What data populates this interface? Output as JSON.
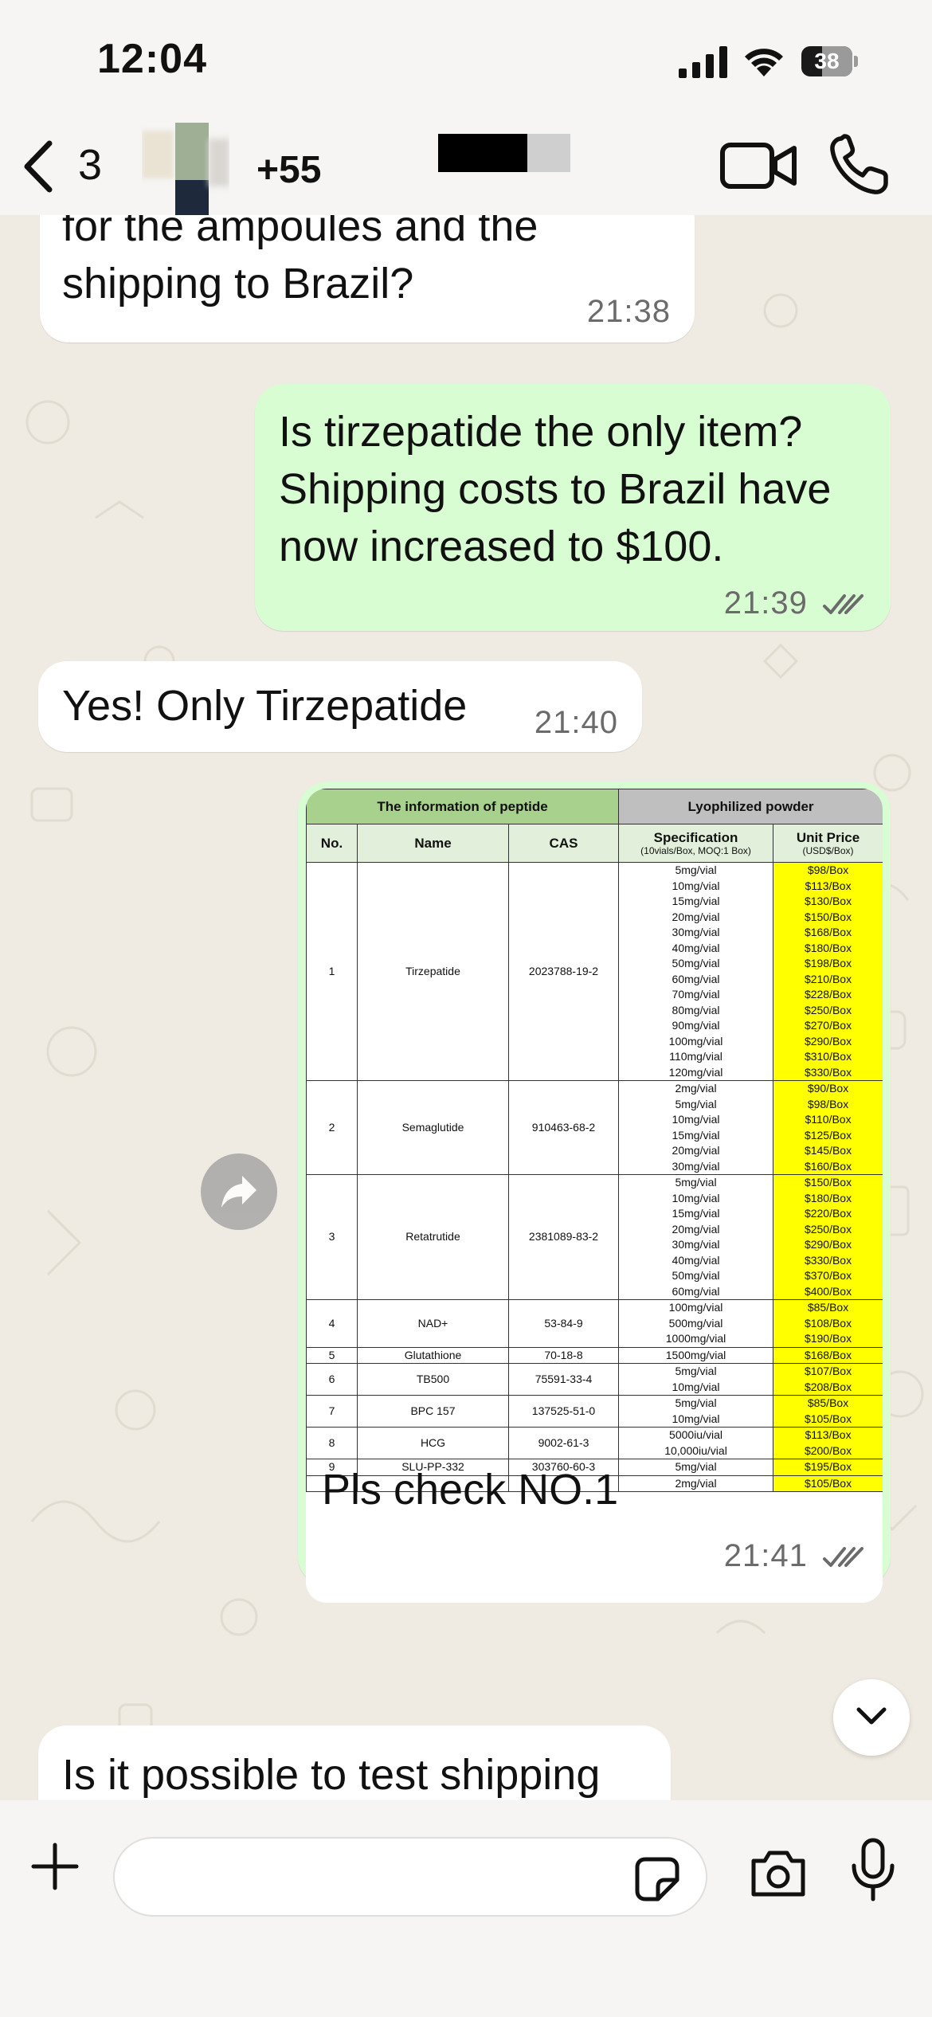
{
  "status_bar": {
    "time": "12:04",
    "battery": "38"
  },
  "header": {
    "back_count": "3",
    "contact_name": "+55"
  },
  "messages": [
    {
      "direction": "in",
      "lines": [
        "for the ampoules and the",
        "shipping to Brazil?"
      ],
      "time": "21:38"
    },
    {
      "direction": "out",
      "lines": [
        "Is tirzepatide the only item?",
        "Shipping costs to Brazil have",
        "now increased to $100."
      ],
      "time": "21:39"
    },
    {
      "direction": "in",
      "lines": [
        "Yes! Only Tirzepatide"
      ],
      "time": "21:40"
    },
    {
      "direction": "out",
      "lines": [
        "Pls check NO.1"
      ],
      "time": "21:41"
    },
    {
      "direction": "in",
      "lines": [
        "Is it possible to test shipping"
      ]
    }
  ],
  "price_table": {
    "group_header_left": "The information of peptide",
    "group_header_right": "Lyophilized powder",
    "col_no": "No.",
    "col_name": "Name",
    "col_cas": "CAS",
    "col_spec": "Specification",
    "col_spec_sub": "(10vials/Box, MOQ:1 Box)",
    "col_price": "Unit Price",
    "col_price_sub": "(USD$/Box)",
    "rows": [
      {
        "no": "1",
        "name": "Tirzepatide",
        "cas": "2023788-19-2",
        "specs": [
          "5mg/vial",
          "10mg/vial",
          "15mg/vial",
          "20mg/vial",
          "30mg/vial",
          "40mg/vial",
          "50mg/vial",
          "60mg/vial",
          "70mg/vial",
          "80mg/vial",
          "90mg/vial",
          "100mg/vial",
          "110mg/vial",
          "120mg/vial"
        ],
        "prices": [
          "$98/Box",
          "$113/Box",
          "$130/Box",
          "$150/Box",
          "$168/Box",
          "$180/Box",
          "$198/Box",
          "$210/Box",
          "$228/Box",
          "$250/Box",
          "$270/Box",
          "$290/Box",
          "$310/Box",
          "$330/Box"
        ]
      },
      {
        "no": "2",
        "name": "Semaglutide",
        "cas": "910463-68-2",
        "specs": [
          "2mg/vial",
          "5mg/vial",
          "10mg/vial",
          "15mg/vial",
          "20mg/vial",
          "30mg/vial"
        ],
        "prices": [
          "$90/Box",
          "$98/Box",
          "$110/Box",
          "$125/Box",
          "$145/Box",
          "$160/Box"
        ]
      },
      {
        "no": "3",
        "name": "Retatrutide",
        "cas": "2381089-83-2",
        "specs": [
          "5mg/vial",
          "10mg/vial",
          "15mg/vial",
          "20mg/vial",
          "30mg/vial",
          "40mg/vial",
          "50mg/vial",
          "60mg/vial"
        ],
        "prices": [
          "$150/Box",
          "$180/Box",
          "$220/Box",
          "$250/Box",
          "$290/Box",
          "$330/Box",
          "$370/Box",
          "$400/Box"
        ]
      },
      {
        "no": "4",
        "name": "NAD+",
        "cas": "53-84-9",
        "specs": [
          "100mg/vial",
          "500mg/vial",
          "1000mg/vial"
        ],
        "prices": [
          "$85/Box",
          "$108/Box",
          "$190/Box"
        ]
      },
      {
        "no": "5",
        "name": "Glutathione",
        "cas": "70-18-8",
        "specs": [
          "1500mg/vial"
        ],
        "prices": [
          "$168/Box"
        ]
      },
      {
        "no": "6",
        "name": "TB500",
        "cas": "75591-33-4",
        "specs": [
          "5mg/vial",
          "10mg/vial"
        ],
        "prices": [
          "$107/Box",
          "$208/Box"
        ]
      },
      {
        "no": "7",
        "name": "BPC 157",
        "cas": "137525-51-0",
        "specs": [
          "5mg/vial",
          "10mg/vial"
        ],
        "prices": [
          "$85/Box",
          "$105/Box"
        ]
      },
      {
        "no": "8",
        "name": "HCG",
        "cas": "9002-61-3",
        "specs": [
          "5000iu/vial",
          "10,000iu/vial"
        ],
        "prices": [
          "$113/Box",
          "$200/Box"
        ]
      },
      {
        "no": "9",
        "name": "SLU-PP-332",
        "cas": "303760-60-3",
        "specs": [
          "5mg/vial"
        ],
        "prices": [
          "$195/Box"
        ]
      },
      {
        "no": "",
        "name": "",
        "cas": "",
        "specs": [
          "2mg/vial"
        ],
        "prices": [
          "$105/Box"
        ]
      }
    ]
  },
  "composer": {
    "placeholder": ""
  },
  "icons": {
    "back": "chevron-left-icon",
    "video": "video-camera-icon",
    "call": "phone-icon",
    "forward": "forward-arrow-icon",
    "scroll_down": "chevron-down-icon",
    "plus": "plus-icon",
    "sticker": "sticker-icon",
    "camera": "camera-icon",
    "mic": "microphone-icon",
    "read_receipt": "double-check-icon"
  },
  "colors": {
    "outgoing_bubble": "#d9fdd3",
    "incoming_bubble": "#ffffff",
    "chat_background": "#efeae2",
    "price_highlight": "#ffff00",
    "table_header_green": "#a9d18e"
  }
}
